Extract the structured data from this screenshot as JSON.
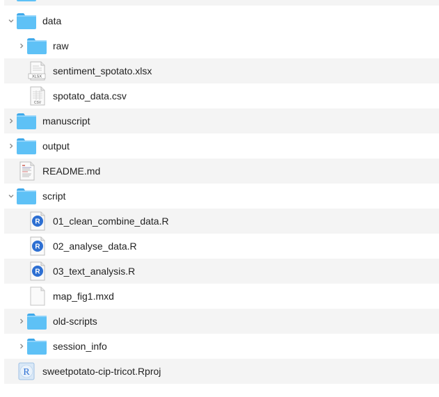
{
  "finder": {
    "items": [
      {
        "name": "data",
        "kind": "folder",
        "depth": 0,
        "expanded": true
      },
      {
        "name": "raw",
        "kind": "folder",
        "depth": 1,
        "expanded": false
      },
      {
        "name": "sentiment_spotato.xlsx",
        "kind": "xlsx",
        "depth": 1,
        "badge": "XLSX"
      },
      {
        "name": "spotato_data.csv",
        "kind": "csv",
        "depth": 1,
        "badge": "CSV"
      },
      {
        "name": "manuscript",
        "kind": "folder",
        "depth": 0,
        "expanded": false
      },
      {
        "name": "output",
        "kind": "folder",
        "depth": 0,
        "expanded": false
      },
      {
        "name": "README.md",
        "kind": "markdown",
        "depth": 0
      },
      {
        "name": "script",
        "kind": "folder",
        "depth": 0,
        "expanded": true
      },
      {
        "name": "01_clean_combine_data.R",
        "kind": "r-script",
        "depth": 1
      },
      {
        "name": "02_analyse_data.R",
        "kind": "r-script",
        "depth": 1
      },
      {
        "name": "03_text_analysis.R",
        "kind": "r-script",
        "depth": 1
      },
      {
        "name": "map_fig1.mxd",
        "kind": "generic",
        "depth": 1
      },
      {
        "name": "old-scripts",
        "kind": "folder",
        "depth": 1,
        "expanded": false
      },
      {
        "name": "session_info",
        "kind": "folder",
        "depth": 1,
        "expanded": false
      },
      {
        "name": "sweetpotato-cip-tricot.Rproj",
        "kind": "rproj",
        "depth": 0
      }
    ]
  },
  "colors": {
    "folder_body": "#5ec1f6",
    "folder_tab": "#3fa9ea",
    "row_alt": "#f4f4f4",
    "r_badge": "#2d6fd2"
  }
}
